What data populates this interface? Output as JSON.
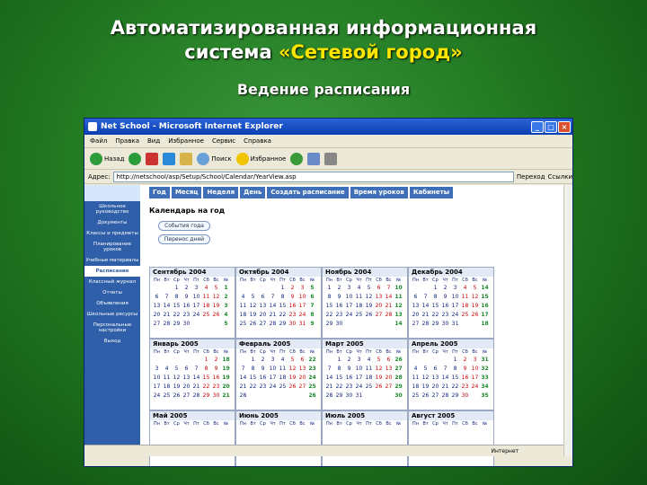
{
  "slide": {
    "title_line1": "Автоматизированная информационная",
    "title_line2_pre": "система ",
    "title_line2_hl": "«Сетевой город»",
    "subtitle": "Ведение расписания"
  },
  "browser": {
    "title": "Net School - Microsoft Internet Explorer",
    "menu": [
      "Файл",
      "Правка",
      "Вид",
      "Избранное",
      "Сервис",
      "Справка"
    ],
    "toolbar": {
      "back": "Назад",
      "search": "Поиск",
      "favorites": "Избранное"
    },
    "address_label": "Адрес:",
    "address": "http://netschool/asp/Setup/School/Calendar/YearView.asp",
    "go": "Переход",
    "links": "Ссылки",
    "status": "Интернет"
  },
  "nav": [
    "Школьное руководство",
    "Документы",
    "Классы и предметы",
    "Планирование уроков",
    "Учебные материалы",
    "Расписание",
    "Классный журнал",
    "Отчеты",
    "Объявления",
    "Школьные ресурсы",
    "Персональные настройки",
    "Выход"
  ],
  "tabs": [
    "Год",
    "Месяц",
    "Неделя",
    "День",
    "Создать расписание",
    "Время уроков",
    "Кабинеты"
  ],
  "page": {
    "heading": "Календарь на год",
    "btn1": "События года",
    "btn2": "Перенос дней"
  },
  "weekdays": [
    "Пн",
    "Вт",
    "Ср",
    "Чт",
    "Пт",
    "Сб",
    "Вс",
    "№"
  ],
  "months": [
    {
      "name": "Сентябрь 2004",
      "weeks": [
        [
          "",
          "",
          "1",
          "2",
          "3",
          "4",
          "5",
          "1"
        ],
        [
          "6",
          "7",
          "8",
          "9",
          "10",
          "11",
          "12",
          "2"
        ],
        [
          "13",
          "14",
          "15",
          "16",
          "17",
          "18",
          "19",
          "3"
        ],
        [
          "20",
          "21",
          "22",
          "23",
          "24",
          "25",
          "26",
          "4"
        ],
        [
          "27",
          "28",
          "29",
          "30",
          "",
          "",
          "",
          "5"
        ]
      ]
    },
    {
      "name": "Октябрь 2004",
      "weeks": [
        [
          "",
          "",
          "",
          "",
          "1",
          "2",
          "3",
          "5"
        ],
        [
          "4",
          "5",
          "6",
          "7",
          "8",
          "9",
          "10",
          "6"
        ],
        [
          "11",
          "12",
          "13",
          "14",
          "15",
          "16",
          "17",
          "7"
        ],
        [
          "18",
          "19",
          "20",
          "21",
          "22",
          "23",
          "24",
          "8"
        ],
        [
          "25",
          "26",
          "27",
          "28",
          "29",
          "30",
          "31",
          "9"
        ]
      ]
    },
    {
      "name": "Ноябрь 2004",
      "weeks": [
        [
          "1",
          "2",
          "3",
          "4",
          "5",
          "6",
          "7",
          "10"
        ],
        [
          "8",
          "9",
          "10",
          "11",
          "12",
          "13",
          "14",
          "11"
        ],
        [
          "15",
          "16",
          "17",
          "18",
          "19",
          "20",
          "21",
          "12"
        ],
        [
          "22",
          "23",
          "24",
          "25",
          "26",
          "27",
          "28",
          "13"
        ],
        [
          "29",
          "30",
          "",
          "",
          "",
          "",
          "",
          "14"
        ]
      ]
    },
    {
      "name": "Декабрь 2004",
      "weeks": [
        [
          "",
          "",
          "1",
          "2",
          "3",
          "4",
          "5",
          "14"
        ],
        [
          "6",
          "7",
          "8",
          "9",
          "10",
          "11",
          "12",
          "15"
        ],
        [
          "13",
          "14",
          "15",
          "16",
          "17",
          "18",
          "19",
          "16"
        ],
        [
          "20",
          "21",
          "22",
          "23",
          "24",
          "25",
          "26",
          "17"
        ],
        [
          "27",
          "28",
          "29",
          "30",
          "31",
          "",
          "",
          "18"
        ]
      ]
    },
    {
      "name": "Январь 2005",
      "weeks": [
        [
          "",
          "",
          "",
          "",
          "",
          "1",
          "2",
          "18"
        ],
        [
          "3",
          "4",
          "5",
          "6",
          "7",
          "8",
          "9",
          "19"
        ],
        [
          "10",
          "11",
          "12",
          "13",
          "14",
          "15",
          "16",
          "19"
        ],
        [
          "17",
          "18",
          "19",
          "20",
          "21",
          "22",
          "23",
          "20"
        ],
        [
          "24",
          "25",
          "26",
          "27",
          "28",
          "29",
          "30",
          "21"
        ]
      ]
    },
    {
      "name": "Февраль 2005",
      "weeks": [
        [
          "",
          "1",
          "2",
          "3",
          "4",
          "5",
          "6",
          "22"
        ],
        [
          "7",
          "8",
          "9",
          "10",
          "11",
          "12",
          "13",
          "23"
        ],
        [
          "14",
          "15",
          "16",
          "17",
          "18",
          "19",
          "20",
          "24"
        ],
        [
          "21",
          "22",
          "23",
          "24",
          "25",
          "26",
          "27",
          "25"
        ],
        [
          "28",
          "",
          "",
          "",
          "",
          "",
          "",
          "26"
        ]
      ]
    },
    {
      "name": "Март 2005",
      "weeks": [
        [
          "",
          "1",
          "2",
          "3",
          "4",
          "5",
          "6",
          "26"
        ],
        [
          "7",
          "8",
          "9",
          "10",
          "11",
          "12",
          "13",
          "27"
        ],
        [
          "14",
          "15",
          "16",
          "17",
          "18",
          "19",
          "20",
          "28"
        ],
        [
          "21",
          "22",
          "23",
          "24",
          "25",
          "26",
          "27",
          "29"
        ],
        [
          "28",
          "29",
          "30",
          "31",
          "",
          "",
          "",
          "30"
        ]
      ]
    },
    {
      "name": "Апрель 2005",
      "weeks": [
        [
          "",
          "",
          "",
          "",
          "1",
          "2",
          "3",
          "31"
        ],
        [
          "4",
          "5",
          "6",
          "7",
          "8",
          "9",
          "10",
          "32"
        ],
        [
          "11",
          "12",
          "13",
          "14",
          "15",
          "16",
          "17",
          "33"
        ],
        [
          "18",
          "19",
          "20",
          "21",
          "22",
          "23",
          "24",
          "34"
        ],
        [
          "25",
          "26",
          "27",
          "28",
          "29",
          "30",
          "",
          "35"
        ]
      ]
    },
    {
      "name": "Май 2005",
      "weeks": []
    },
    {
      "name": "Июнь 2005",
      "weeks": []
    },
    {
      "name": "Июль 2005",
      "weeks": []
    },
    {
      "name": "Август 2005",
      "weeks": []
    }
  ]
}
